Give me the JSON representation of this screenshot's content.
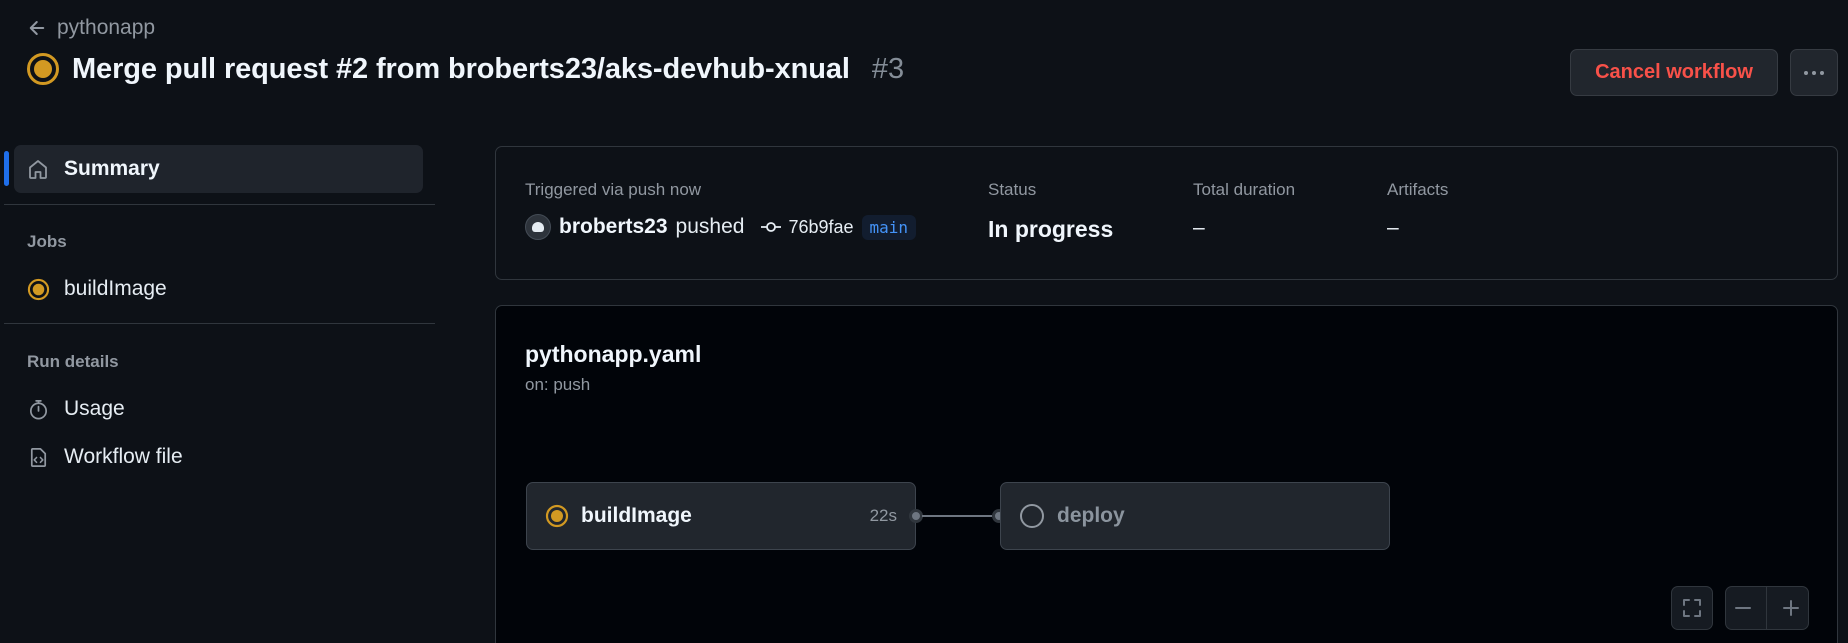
{
  "header": {
    "back_label": "pythonapp",
    "title": "Merge pull request #2 from broberts23/aks-devhub-xnual",
    "run_number": "#3",
    "cancel_label": "Cancel workflow"
  },
  "sidebar": {
    "summary_label": "Summary",
    "jobs_heading": "Jobs",
    "jobs": [
      {
        "label": "buildImage",
        "status": "in-progress"
      }
    ],
    "run_details_heading": "Run details",
    "details": [
      {
        "label": "Usage",
        "icon": "stopwatch-icon"
      },
      {
        "label": "Workflow file",
        "icon": "file-code-icon"
      }
    ]
  },
  "summary": {
    "trigger_label": "Triggered via push now",
    "user": "broberts23",
    "action": "pushed",
    "commit": "76b9fae",
    "branch": "main",
    "status_label": "Status",
    "status_value": "In progress",
    "duration_label": "Total duration",
    "duration_value": "–",
    "artifacts_label": "Artifacts",
    "artifacts_value": "–"
  },
  "workflow": {
    "file": "pythonapp.yaml",
    "trigger": "on: push",
    "jobs": [
      {
        "name": "buildImage",
        "duration": "22s",
        "status": "in-progress"
      },
      {
        "name": "deploy",
        "duration": "",
        "status": "pending"
      }
    ]
  },
  "colors": {
    "accent": "#1f6feb",
    "in_progress": "#d29922",
    "danger": "#f85149",
    "link": "#4493f8"
  }
}
